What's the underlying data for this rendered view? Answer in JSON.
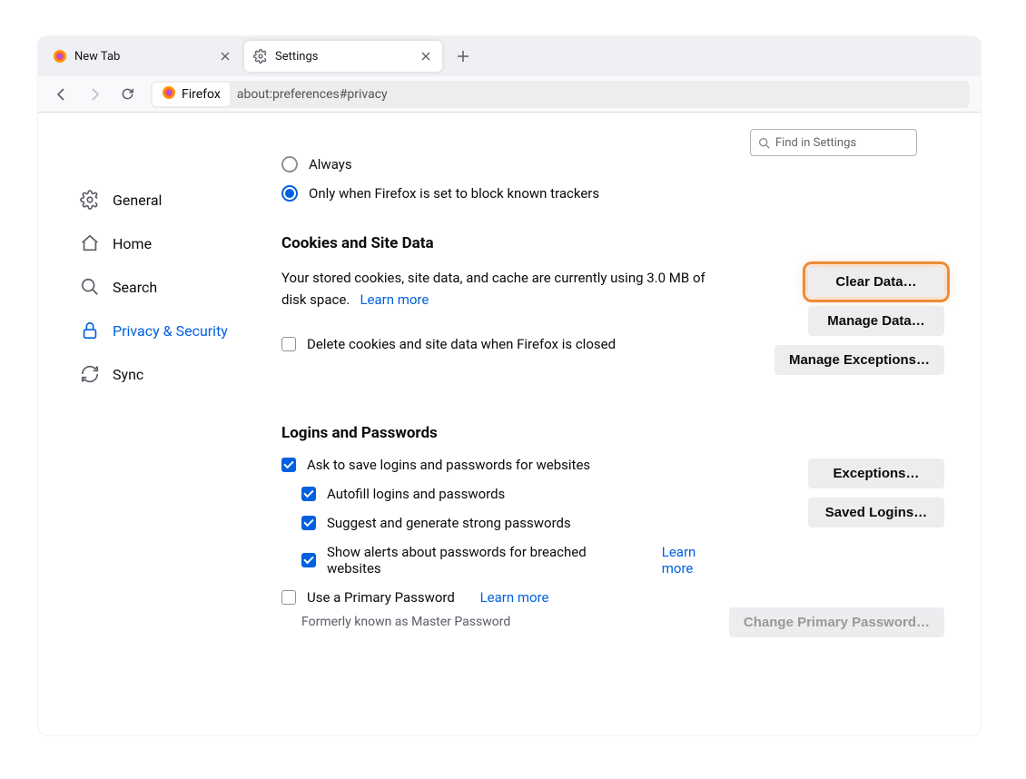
{
  "tabs": {
    "items": [
      {
        "label": "New Tab"
      },
      {
        "label": "Settings"
      }
    ]
  },
  "toolbar": {
    "identity_label": "Firefox",
    "url": "about:preferences#privacy"
  },
  "search": {
    "placeholder": "Find in Settings"
  },
  "sidebar": {
    "items": [
      {
        "label": "General"
      },
      {
        "label": "Home"
      },
      {
        "label": "Search"
      },
      {
        "label": "Privacy & Security"
      },
      {
        "label": "Sync"
      }
    ]
  },
  "main": {
    "tracking": {
      "radio_always": "Always",
      "radio_only": "Only when Firefox is set to block known trackers"
    },
    "cookies": {
      "heading": "Cookies and Site Data",
      "desc": "Your stored cookies, site data, and cache are currently using 3.0 MB of disk space.",
      "learn_more": "Learn more",
      "delete_on_close": "Delete cookies and site data when Firefox is closed",
      "clear_data": "Clear Data…",
      "manage_data": "Manage Data…",
      "manage_exceptions": "Manage Exceptions…"
    },
    "logins": {
      "heading": "Logins and Passwords",
      "ask_save": "Ask to save logins and passwords for websites",
      "autofill": "Autofill logins and passwords",
      "suggest": "Suggest and generate strong passwords",
      "breach": "Show alerts about passwords for breached websites",
      "breach_learn": "Learn more",
      "primary": "Use a Primary Password",
      "primary_learn": "Learn more",
      "hint": "Formerly known as Master Password",
      "exceptions": "Exceptions…",
      "saved_logins": "Saved Logins…",
      "change_primary": "Change Primary Password…"
    }
  }
}
